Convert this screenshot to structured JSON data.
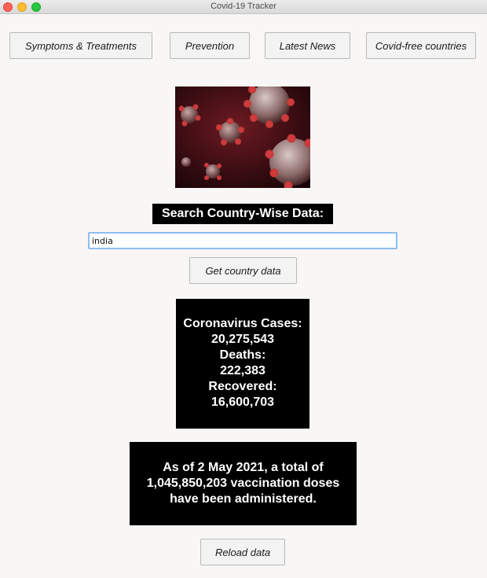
{
  "window": {
    "title": "Covid-19 Tracker"
  },
  "nav": {
    "symptoms": "Symptoms & Treatments",
    "prevention": "Prevention",
    "news": "Latest News",
    "covid_free": "Covid-free countries"
  },
  "search": {
    "label": "Search Country-Wise Data:",
    "value": "india",
    "button": "Get country data"
  },
  "stats": {
    "cases_label": "Coronavirus Cases:",
    "cases": "20,275,543",
    "deaths_label": "Deaths:",
    "deaths": "222,383",
    "recovered_label": "Recovered:",
    "recovered": "16,600,703"
  },
  "vaccination": {
    "line1": "As of 2 May 2021, a total of",
    "line2": "1,045,850,203 vaccination doses",
    "line3": "have been administered."
  },
  "reload": {
    "button": "Reload data"
  }
}
